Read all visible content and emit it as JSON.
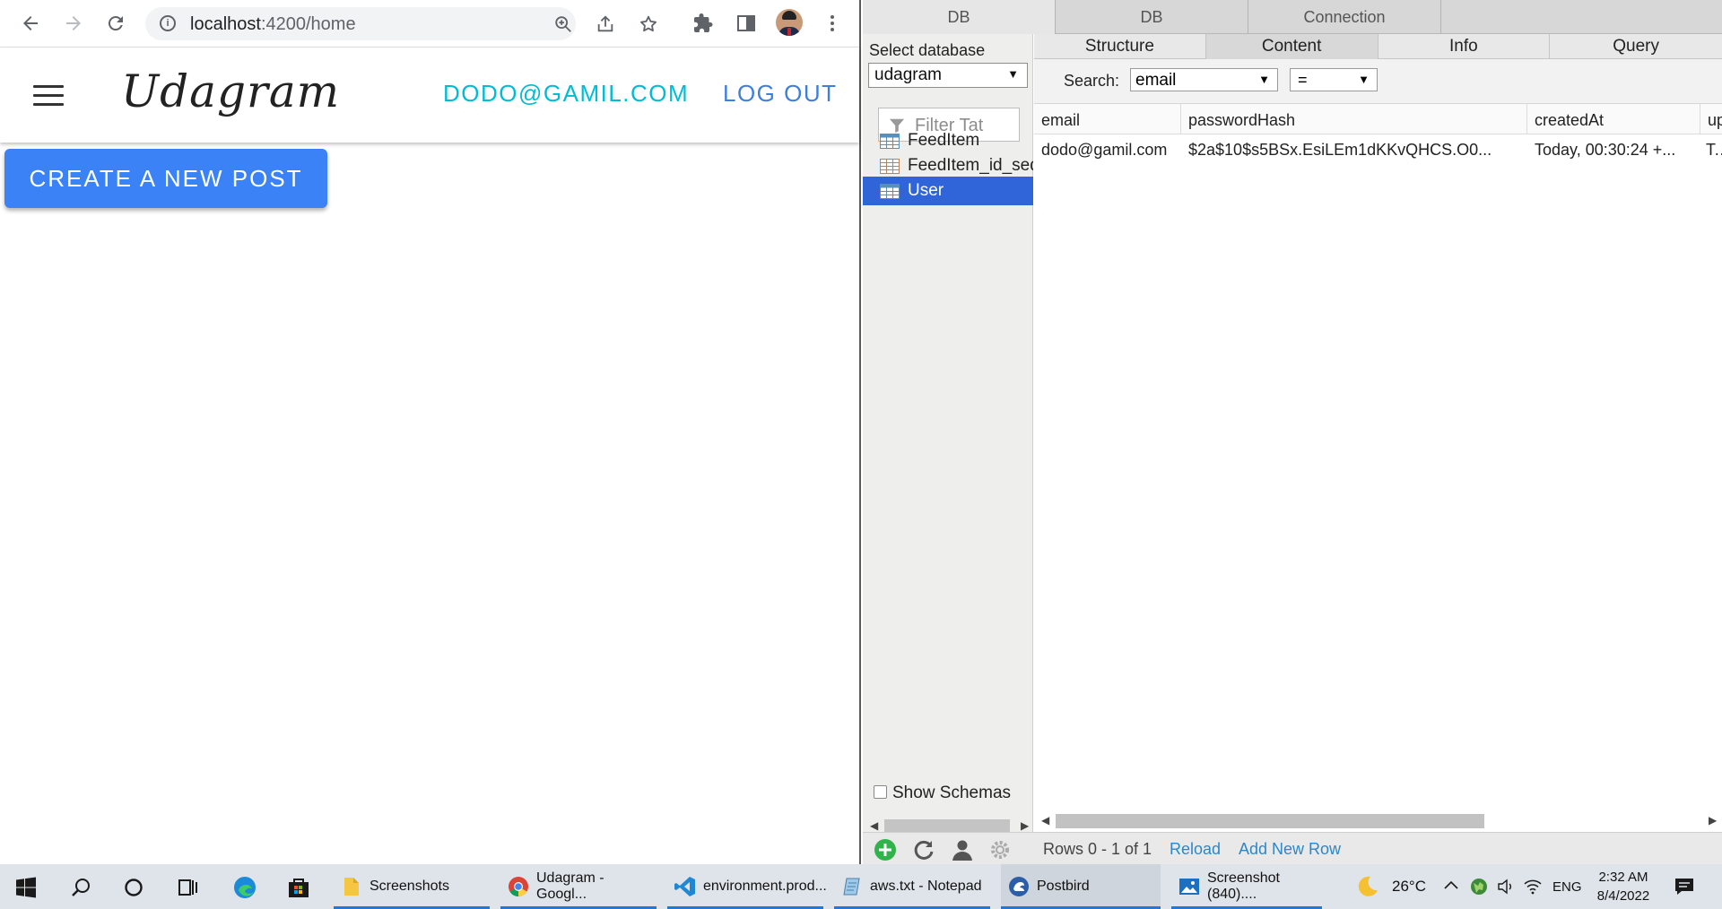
{
  "browser": {
    "url_host": "localhost",
    "url_path": ":4200/home",
    "app": {
      "brand": "Udagram",
      "user_email": "DODO@GAMIL.COM",
      "logout_label": "LOG OUT",
      "create_post_label": "CREATE A NEW POST"
    }
  },
  "postbird": {
    "top_tabs": [
      "DB",
      "DB",
      "Connection"
    ],
    "select_database_label": "Select database",
    "database": "udagram",
    "filter_placeholder": "Filter Tat",
    "tables": [
      {
        "name": "FeedItem",
        "icon": "table-icon"
      },
      {
        "name": "FeedItem_id_seq",
        "icon": "sequence-icon"
      },
      {
        "name": "User",
        "icon": "table-icon",
        "selected": true
      }
    ],
    "show_schemas_label": "Show Schemas",
    "sub_tabs": [
      "Structure",
      "Content",
      "Info",
      "Query"
    ],
    "active_sub_tab": "Content",
    "search_label": "Search:",
    "search_column": "email",
    "search_operator": "=",
    "columns": [
      "email",
      "passwordHash",
      "createdAt",
      "up"
    ],
    "rows": [
      [
        "dodo@gamil.com",
        "$2a$10$s5BSx.EsiLEm1dKKvQHCS.O0...",
        "Today, 00:30:24 +...",
        "To"
      ]
    ],
    "rows_info": "Rows 0 - 1 of 1",
    "reload_label": "Reload",
    "add_row_label": "Add New Row"
  },
  "taskbar": {
    "apps": [
      {
        "label": "Screenshots",
        "icon": "folder-icon"
      },
      {
        "label": "Udagram - Googl...",
        "icon": "chrome-icon"
      },
      {
        "label": "environment.prod...",
        "icon": "vscode-icon"
      },
      {
        "label": "aws.txt - Notepad",
        "icon": "notepad-icon"
      },
      {
        "label": "Postbird",
        "icon": "postbird-icon"
      },
      {
        "label": "Screenshot (840)....",
        "icon": "photos-icon"
      }
    ],
    "temperature": "26°C",
    "language": "ENG",
    "time": "2:32 AM",
    "date": "8/4/2022"
  },
  "colors": {
    "accent_blue": "#3b82f6",
    "email_cyan": "#00bcd4",
    "selected_row": "#2f65d9",
    "link_blue": "#2d87c7"
  }
}
